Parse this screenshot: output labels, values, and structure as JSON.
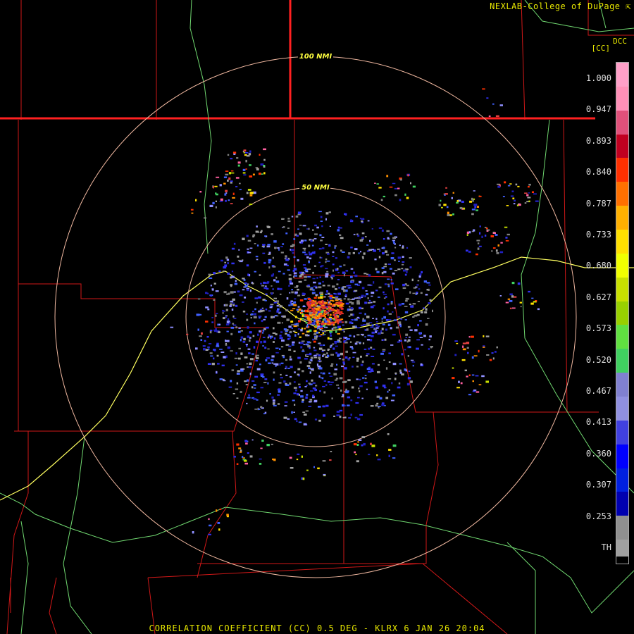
{
  "header": {
    "credit": "NEXLAB-College of DuPage",
    "credit_icon": "cursor-arrow-icon",
    "product_code": "DCC",
    "unit": "[CC]"
  },
  "map": {
    "range_rings": [
      "50 NMI",
      "100 NMI"
    ],
    "colors": {
      "background": "#000000",
      "state_lines": "#ff2020",
      "county_lines": "#d01818",
      "roads": "#70d870",
      "interstate": "#ffff60",
      "rings": "#f0b8a0"
    }
  },
  "legend": {
    "ticks": [
      "1.000",
      "0.947",
      "0.893",
      "0.840",
      "0.787",
      "0.733",
      "0.680",
      "0.627",
      "0.573",
      "0.520",
      "0.467",
      "0.413",
      "0.360",
      "0.307",
      "0.253",
      "TH"
    ],
    "colors": [
      "#ff9fc8",
      "#ff90b8",
      "#e0507a",
      "#c00020",
      "#ff3000",
      "#ff7000",
      "#ffb000",
      "#ffe000",
      "#f0ff00",
      "#c8e000",
      "#98d000",
      "#60e040",
      "#40d060",
      "#8080d0",
      "#9090e0",
      "#4040e0",
      "#0000ff",
      "#0020e0",
      "#0000b0",
      "#909090",
      "#a0a0a0"
    ]
  },
  "footer": {
    "caption": "CORRELATION COEFFICIENT (CC) 0.5 DEG - KLRX 6 JAN 26 20:04"
  }
}
